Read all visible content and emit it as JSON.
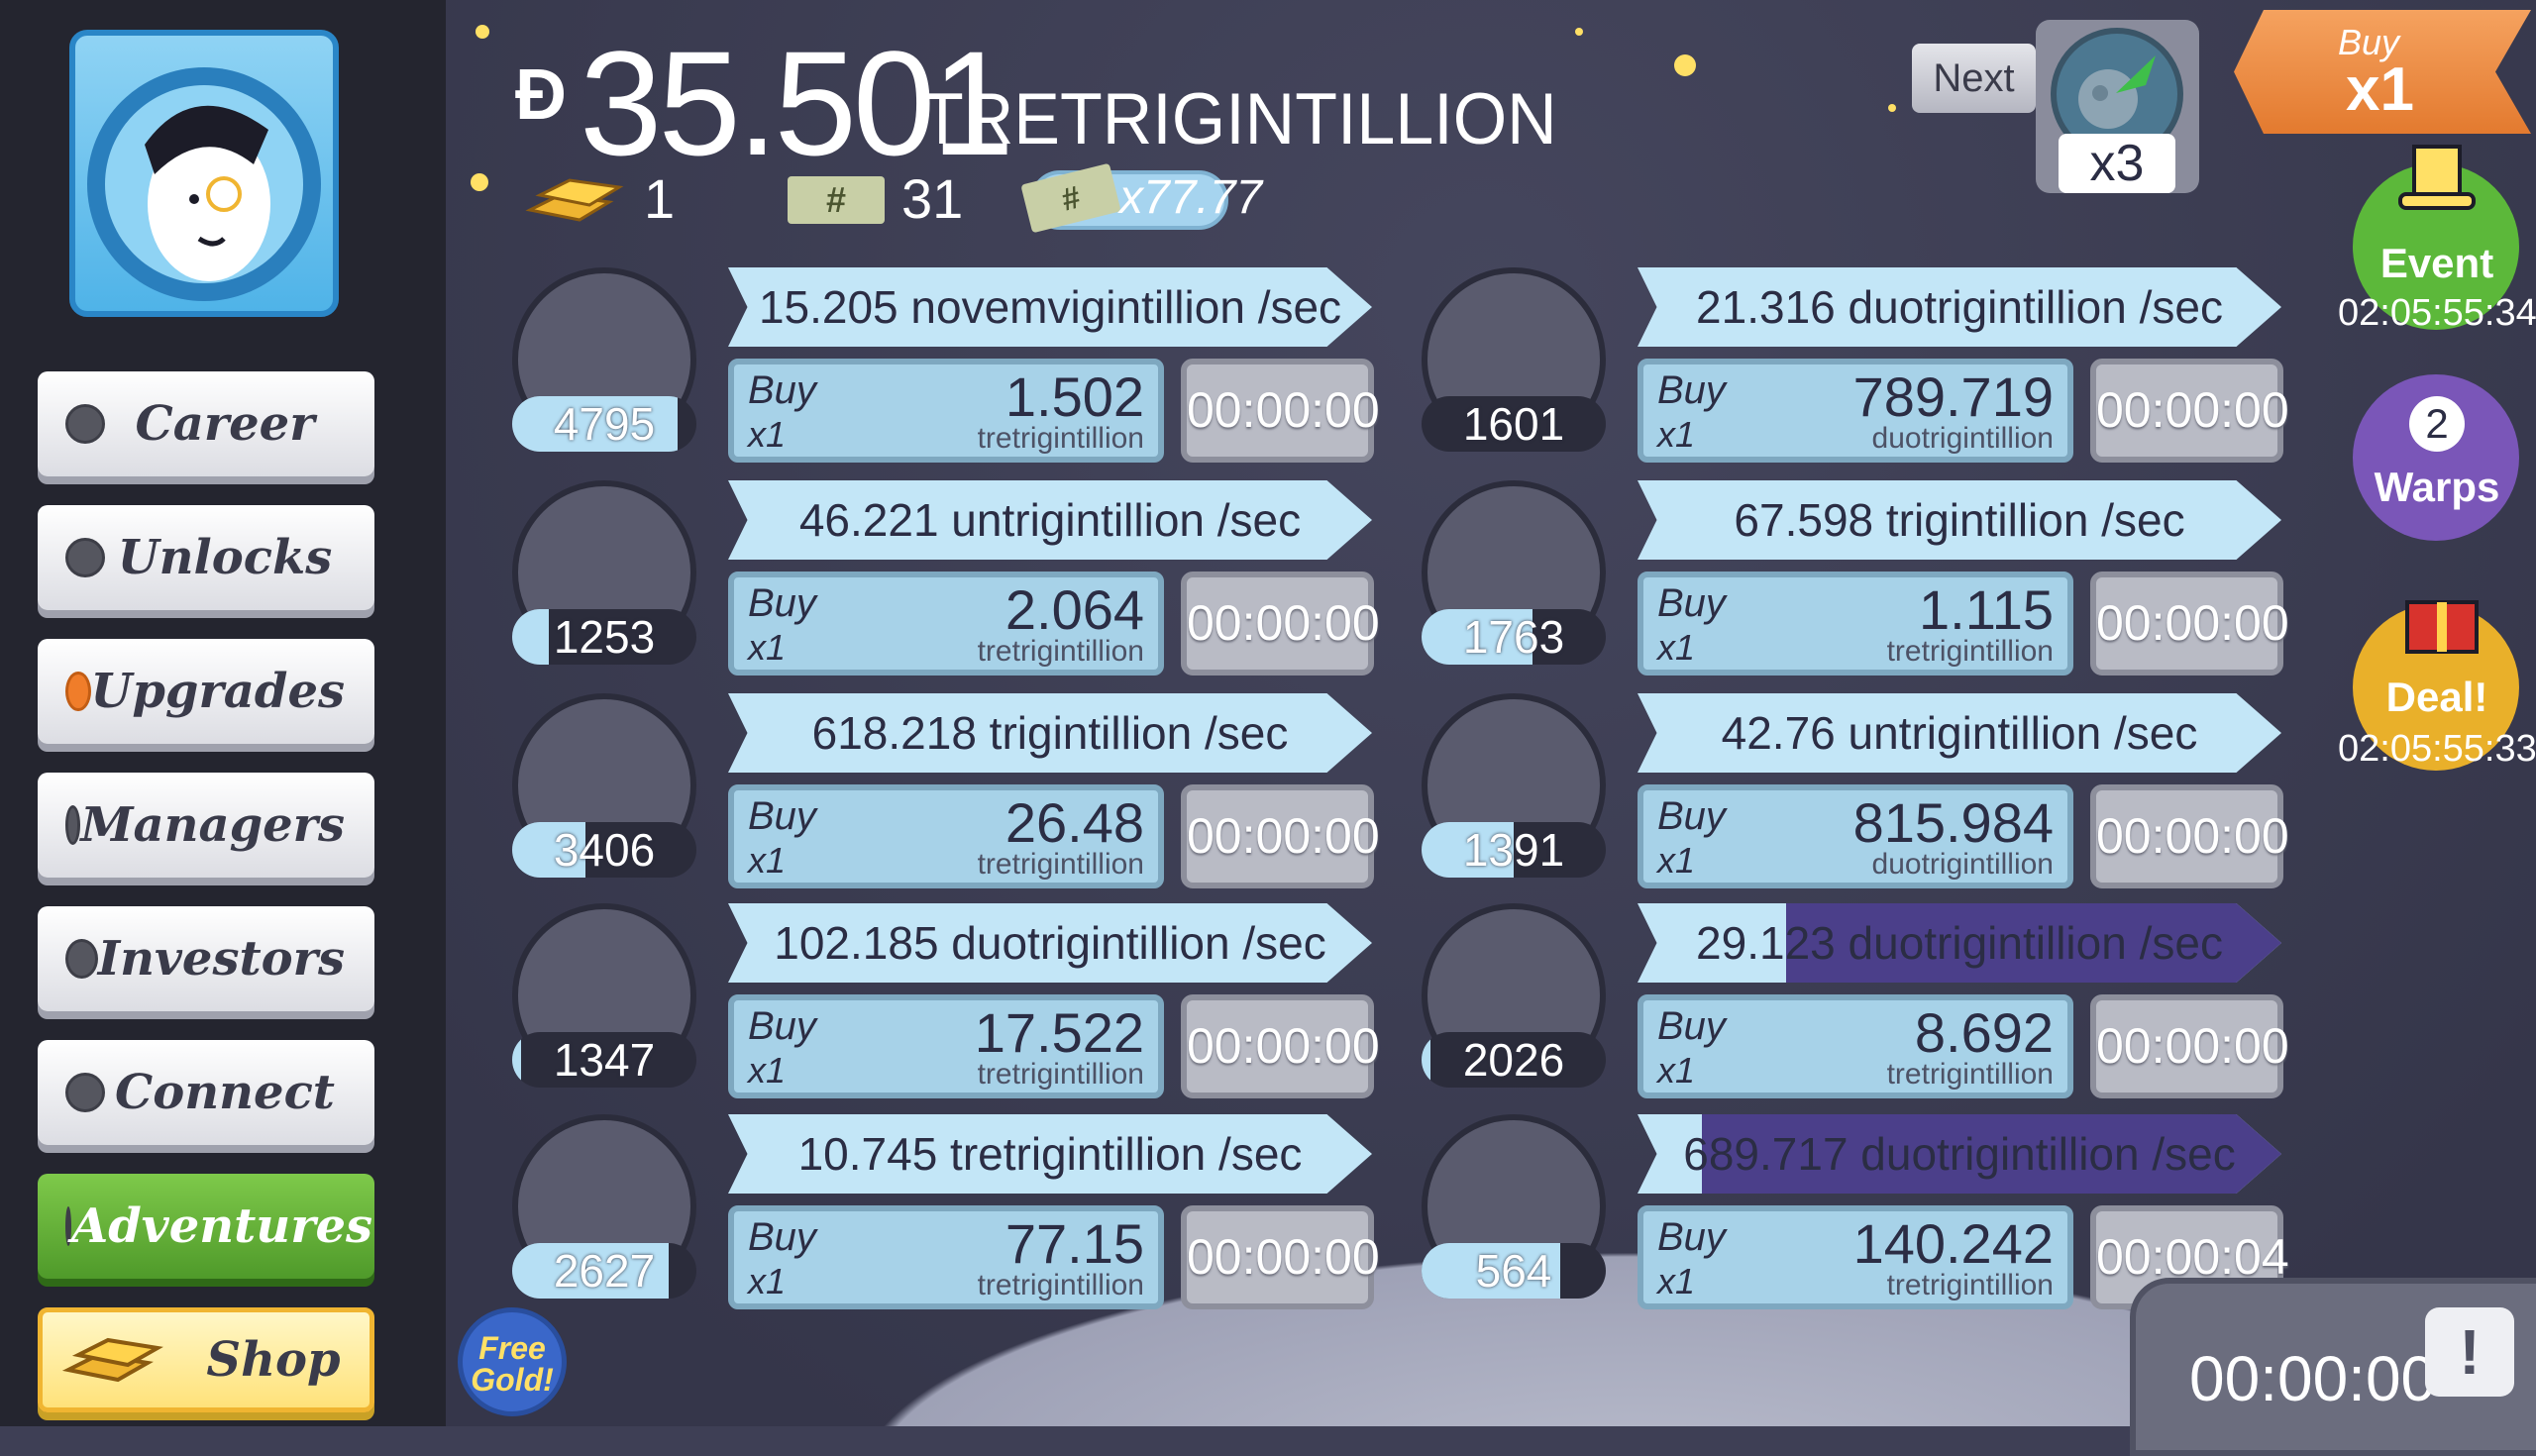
{
  "header": {
    "currency_symbol": "Ɖ",
    "money_value": "35.501",
    "money_unit": "TRETRIGINTILLION",
    "gold_count": "1",
    "megabucks_label": "#",
    "megabucks_count": "31",
    "boost_bill_label": "#",
    "boost_multiplier": "x77.77",
    "next_label": "Next",
    "next_multiplier": "x3",
    "buy_tag_line1": "Buy",
    "buy_tag_line2": "x1"
  },
  "sidebar": {
    "items": [
      {
        "label": "Career"
      },
      {
        "label": "Unlocks"
      },
      {
        "label": "Upgrades"
      },
      {
        "label": "Managers"
      },
      {
        "label": "Investors"
      },
      {
        "label": "Connect"
      },
      {
        "label": "Adventures"
      },
      {
        "label": "Shop"
      }
    ]
  },
  "badges": {
    "event_label": "Event",
    "event_timer": "02:05:55:34",
    "warps_count": "2",
    "warps_label": "Warps",
    "deal_label": "Deal!",
    "deal_timer": "02:05:55:33"
  },
  "businesses": [
    {
      "icon": "moon-boots-icon",
      "count": "4795",
      "count_progress": 0.9,
      "revenue": "15.205 novemvigintillion /sec",
      "revenue_progress": 0,
      "buy_label": "Buy",
      "buy_qty": "x1",
      "price": "1.502",
      "price_unit": "tretrigintillion",
      "timer": "00:00:00"
    },
    {
      "icon": "barn-dome-icon",
      "count": "1601",
      "count_progress": 0,
      "revenue": "21.316 duotrigintillion /sec",
      "revenue_progress": 0,
      "buy_label": "Buy",
      "buy_qty": "x1",
      "price": "789.719",
      "price_unit": "duotrigintillion",
      "timer": "00:00:00"
    },
    {
      "icon": "phone-booth-icon",
      "count": "1253",
      "count_progress": 0.2,
      "revenue": "46.221 untrigintillion /sec",
      "revenue_progress": 0,
      "buy_label": "Buy",
      "buy_qty": "x1",
      "price": "2.064",
      "price_unit": "tretrigintillion",
      "timer": "00:00:00"
    },
    {
      "icon": "cheese-minecart-icon",
      "count": "1763",
      "count_progress": 0.6,
      "revenue": "67.598 trigintillion /sec",
      "revenue_progress": 0,
      "buy_label": "Buy",
      "buy_qty": "x1",
      "price": "1.115",
      "price_unit": "tretrigintillion",
      "timer": "00:00:00"
    },
    {
      "icon": "clones-icon",
      "count": "3406",
      "count_progress": 0.4,
      "revenue": "618.218 trigintillion /sec",
      "revenue_progress": 0,
      "buy_label": "Buy",
      "buy_qty": "x1",
      "price": "26.48",
      "price_unit": "tretrigintillion",
      "timer": "00:00:00"
    },
    {
      "icon": "space-coaster-icon",
      "count": "1391",
      "count_progress": 0.5,
      "revenue": "42.76 untrigintillion /sec",
      "revenue_progress": 0,
      "buy_label": "Buy",
      "buy_qty": "x1",
      "price": "815.984",
      "price_unit": "duotrigintillion",
      "timer": "00:00:00"
    },
    {
      "icon": "moon-rocket-icon",
      "count": "1347",
      "count_progress": 0.05,
      "revenue": "102.185 duotrigintillion /sec",
      "revenue_progress": 0,
      "buy_label": "Buy",
      "buy_qty": "x1",
      "price": "17.522",
      "price_unit": "tretrigintillion",
      "timer": "00:00:00"
    },
    {
      "icon": "werewolf-icon",
      "count": "2026",
      "count_progress": 0.05,
      "revenue": "29.123 duotrigintillion /sec",
      "revenue_progress": 0.77,
      "buy_label": "Buy",
      "buy_qty": "x1",
      "price": "8.692",
      "price_unit": "tretrigintillion",
      "timer": "00:00:00"
    },
    {
      "icon": "cocktail-icon",
      "count": "2627",
      "count_progress": 0.85,
      "revenue": "10.745 tretrigintillion /sec",
      "revenue_progress": 0,
      "buy_label": "Buy",
      "buy_qty": "x1",
      "price": "77.15",
      "price_unit": "tretrigintillion",
      "timer": "00:00:00"
    },
    {
      "icon": "ray-gun-icon",
      "count": "564",
      "count_progress": 0.75,
      "revenue": "689.717 duotrigintillion /sec",
      "revenue_progress": 0.9,
      "buy_label": "Buy",
      "buy_qty": "x1",
      "price": "140.242",
      "price_unit": "tretrigintillion",
      "timer": "00:00:04"
    }
  ],
  "bottom": {
    "free_gold_label": "Free Gold!",
    "tv_timer": "00:00:00",
    "tv_icon_glyph": "!"
  }
}
